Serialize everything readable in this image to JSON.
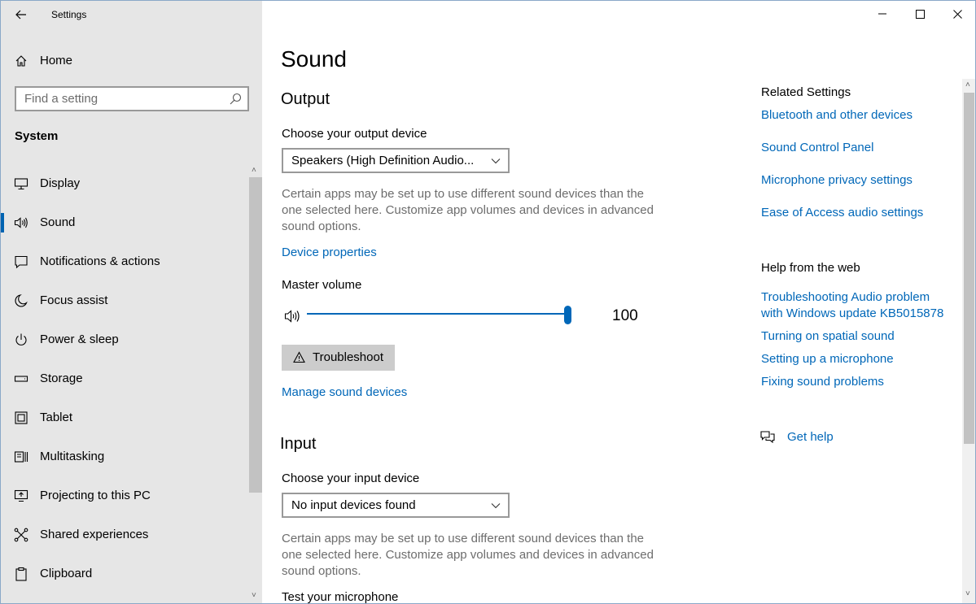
{
  "window": {
    "title": "Settings",
    "controls": {
      "minimize": "minimize-icon",
      "maximize": "maximize-icon",
      "close": "close-icon"
    }
  },
  "sidebar": {
    "home_label": "Home",
    "search_placeholder": "Find a setting",
    "section": "System",
    "items": [
      {
        "label": "Display",
        "icon": "display-icon",
        "selected": false
      },
      {
        "label": "Sound",
        "icon": "speaker-icon",
        "selected": true
      },
      {
        "label": "Notifications & actions",
        "icon": "notifications-icon",
        "selected": false
      },
      {
        "label": "Focus assist",
        "icon": "moon-icon",
        "selected": false
      },
      {
        "label": "Power & sleep",
        "icon": "power-icon",
        "selected": false
      },
      {
        "label": "Storage",
        "icon": "storage-icon",
        "selected": false
      },
      {
        "label": "Tablet",
        "icon": "tablet-icon",
        "selected": false
      },
      {
        "label": "Multitasking",
        "icon": "multitasking-icon",
        "selected": false
      },
      {
        "label": "Projecting to this PC",
        "icon": "projecting-icon",
        "selected": false
      },
      {
        "label": "Shared experiences",
        "icon": "shared-icon",
        "selected": false
      },
      {
        "label": "Clipboard",
        "icon": "clipboard-icon",
        "selected": false
      }
    ]
  },
  "main": {
    "title": "Sound",
    "output": {
      "heading": "Output",
      "device_label": "Choose your output device",
      "device_value": "Speakers (High Definition Audio...",
      "description": "Certain apps may be set up to use different sound devices than the one selected here. Customize app volumes and devices in advanced sound options.",
      "device_properties_link": "Device properties",
      "volume_label": "Master volume",
      "volume_value": "100",
      "volume_fraction": 1.0,
      "troubleshoot_label": "Troubleshoot",
      "manage_link": "Manage sound devices"
    },
    "input": {
      "heading": "Input",
      "device_label": "Choose your input device",
      "device_value": "No input devices found",
      "description": "Certain apps may be set up to use different sound devices than the one selected here. Customize app volumes and devices in advanced sound options.",
      "test_label": "Test your microphone"
    }
  },
  "related": {
    "heading": "Related Settings",
    "links": [
      "Bluetooth and other devices",
      "Sound Control Panel",
      "Microphone privacy settings",
      "Ease of Access audio settings"
    ]
  },
  "help": {
    "heading": "Help from the web",
    "links": [
      "Troubleshooting Audio problem with Windows update KB5015878",
      "Turning on spatial sound",
      "Setting up a microphone",
      "Fixing sound problems"
    ],
    "get_help": "Get help"
  },
  "colors": {
    "accent": "#0067b8",
    "sidebar_bg": "#e6e6e6",
    "muted_text": "#6d6d6d"
  }
}
